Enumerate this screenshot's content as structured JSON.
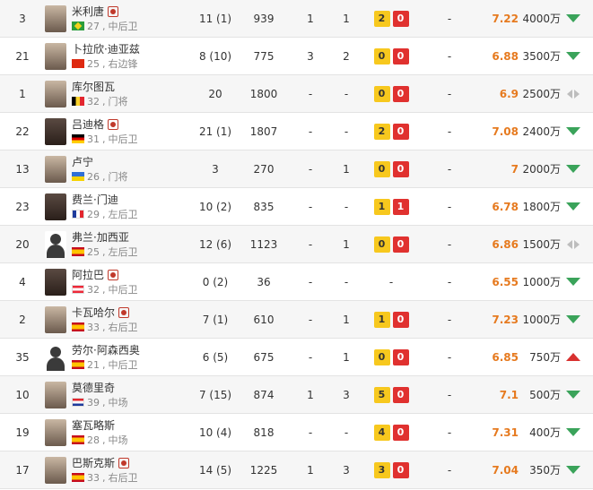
{
  "rows": [
    {
      "number": "3",
      "name": "米利唐",
      "captain": true,
      "flag": "brazil",
      "age": "27",
      "position": "中后卫",
      "apps": "11 (1)",
      "minutes": "939",
      "goals": "1",
      "assists": "1",
      "yellow": "2",
      "red": "0",
      "col": "-",
      "rating": "7.22",
      "value": "4000万",
      "trend": "down",
      "avatar": "skin"
    },
    {
      "number": "21",
      "name": "卜拉欣·迪亚兹",
      "captain": false,
      "flag": "china",
      "age": "25",
      "position": "右边锋",
      "apps": "8 (10)",
      "minutes": "775",
      "goals": "3",
      "assists": "2",
      "yellow": "0",
      "red": "0",
      "col": "-",
      "rating": "6.88",
      "value": "3500万",
      "trend": "down",
      "avatar": "skin"
    },
    {
      "number": "1",
      "name": "库尔图瓦",
      "captain": false,
      "flag": "belgium",
      "age": "32",
      "position": "门将",
      "apps": "20",
      "minutes": "1800",
      "goals": "-",
      "assists": "-",
      "yellow": "0",
      "red": "0",
      "col": "-",
      "rating": "6.9",
      "value": "2500万",
      "trend": "flat",
      "avatar": "skin"
    },
    {
      "number": "22",
      "name": "吕迪格",
      "captain": true,
      "flag": "germany",
      "age": "31",
      "position": "中后卫",
      "apps": "21 (1)",
      "minutes": "1807",
      "goals": "-",
      "assists": "-",
      "yellow": "2",
      "red": "0",
      "col": "-",
      "rating": "7.08",
      "value": "2400万",
      "trend": "down",
      "avatar": "dark"
    },
    {
      "number": "13",
      "name": "卢宁",
      "captain": false,
      "flag": "ukraine",
      "age": "26",
      "position": "门将",
      "apps": "3",
      "minutes": "270",
      "goals": "-",
      "assists": "1",
      "yellow": "0",
      "red": "0",
      "col": "-",
      "rating": "7",
      "value": "2000万",
      "trend": "down",
      "avatar": "skin"
    },
    {
      "number": "23",
      "name": "费兰·门迪",
      "captain": false,
      "flag": "france",
      "age": "29",
      "position": "左后卫",
      "apps": "10 (2)",
      "minutes": "835",
      "goals": "-",
      "assists": "-",
      "yellow": "1",
      "red": "1",
      "col": "-",
      "rating": "6.78",
      "value": "1800万",
      "trend": "down",
      "avatar": "dark"
    },
    {
      "number": "20",
      "name": "弗兰·加西亚",
      "captain": false,
      "flag": "spain",
      "age": "25",
      "position": "左后卫",
      "apps": "12 (6)",
      "minutes": "1123",
      "goals": "-",
      "assists": "1",
      "yellow": "0",
      "red": "0",
      "col": "-",
      "rating": "6.86",
      "value": "1500万",
      "trend": "flat",
      "avatar": "silhouette"
    },
    {
      "number": "4",
      "name": "阿拉巴",
      "captain": true,
      "flag": "austria",
      "age": "32",
      "position": "中后卫",
      "apps": "0 (2)",
      "minutes": "36",
      "goals": "-",
      "assists": "-",
      "yellow": "",
      "red": "",
      "col": "-",
      "rating": "6.55",
      "value": "1000万",
      "trend": "down",
      "avatar": "dark",
      "dash_cards": "-"
    },
    {
      "number": "2",
      "name": "卡瓦哈尔",
      "captain": true,
      "flag": "spain",
      "age": "33",
      "position": "右后卫",
      "apps": "7 (1)",
      "minutes": "610",
      "goals": "-",
      "assists": "1",
      "yellow": "1",
      "red": "0",
      "col": "-",
      "rating": "7.23",
      "value": "1000万",
      "trend": "down",
      "avatar": "skin"
    },
    {
      "number": "35",
      "name": "劳尔·阿森西奥",
      "captain": false,
      "flag": "spain",
      "age": "21",
      "position": "中后卫",
      "apps": "6 (5)",
      "minutes": "675",
      "goals": "-",
      "assists": "1",
      "yellow": "0",
      "red": "0",
      "col": "-",
      "rating": "6.85",
      "value": "750万",
      "trend": "up",
      "avatar": "silhouette"
    },
    {
      "number": "10",
      "name": "莫德里奇",
      "captain": false,
      "flag": "croatia",
      "age": "39",
      "position": "中场",
      "apps": "7 (15)",
      "minutes": "874",
      "goals": "1",
      "assists": "3",
      "yellow": "5",
      "red": "0",
      "col": "-",
      "rating": "7.1",
      "value": "500万",
      "trend": "down",
      "avatar": "skin"
    },
    {
      "number": "19",
      "name": "塞瓦略斯",
      "captain": false,
      "flag": "spain",
      "age": "28",
      "position": "中场",
      "apps": "10 (4)",
      "minutes": "818",
      "goals": "-",
      "assists": "-",
      "yellow": "4",
      "red": "0",
      "col": "-",
      "rating": "7.31",
      "value": "400万",
      "trend": "down",
      "avatar": "skin"
    },
    {
      "number": "17",
      "name": "巴斯克斯",
      "captain": true,
      "flag": "spain",
      "age": "33",
      "position": "右后卫",
      "apps": "14 (5)",
      "minutes": "1225",
      "goals": "1",
      "assists": "3",
      "yellow": "3",
      "red": "0",
      "col": "-",
      "rating": "7.04",
      "value": "350万",
      "trend": "down",
      "avatar": "skin"
    }
  ]
}
